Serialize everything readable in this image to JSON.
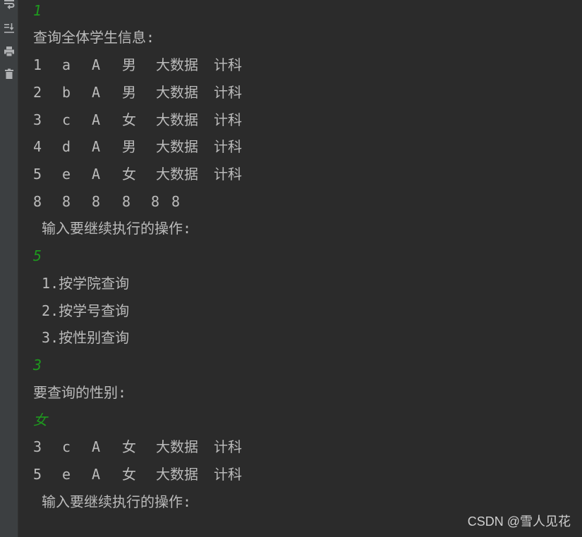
{
  "sidebar": {
    "tools": [
      {
        "name": "soft-wrap",
        "icon": "soft-wrap-icon"
      },
      {
        "name": "scroll-to-end",
        "icon": "scroll-to-end-icon"
      },
      {
        "name": "print",
        "icon": "print-icon"
      },
      {
        "name": "clear-all",
        "icon": "trash-icon"
      }
    ]
  },
  "console": {
    "input_1": "1",
    "header_all": "查询全体学生信息:",
    "students_all": [
      [
        "1",
        "a",
        "A",
        "男",
        "大数据",
        "计科"
      ],
      [
        "2",
        "b",
        "A",
        "男",
        "大数据",
        "计科"
      ],
      [
        "3",
        "c",
        "A",
        "女",
        "大数据",
        "计科"
      ],
      [
        "4",
        "d",
        "A",
        "男",
        "大数据",
        "计科"
      ],
      [
        "5",
        "e",
        "A",
        "女",
        "大数据",
        "计科"
      ],
      [
        "8",
        "8",
        "8",
        "8",
        "8",
        "8"
      ]
    ],
    "prompt_op_1": " 输入要继续执行的操作:",
    "input_2": "5",
    "menu": [
      " 1.按学院查询",
      " 2.按学号查询",
      " 3.按性别查询"
    ],
    "input_3": "3",
    "prompt_gender": "要查询的性别:",
    "input_4": "女",
    "students_result": [
      [
        "3",
        "c",
        "A",
        "女",
        "大数据",
        "计科"
      ],
      [
        "5",
        "e",
        "A",
        "女",
        "大数据",
        "计科"
      ]
    ],
    "prompt_op_2": " 输入要继续执行的操作:"
  },
  "watermark": "CSDN @雪人见花",
  "colors": {
    "background": "#2b2b2b",
    "sidebar": "#3c3f41",
    "text": "#bbbbbb",
    "input_echo": "#1e9a1e"
  }
}
